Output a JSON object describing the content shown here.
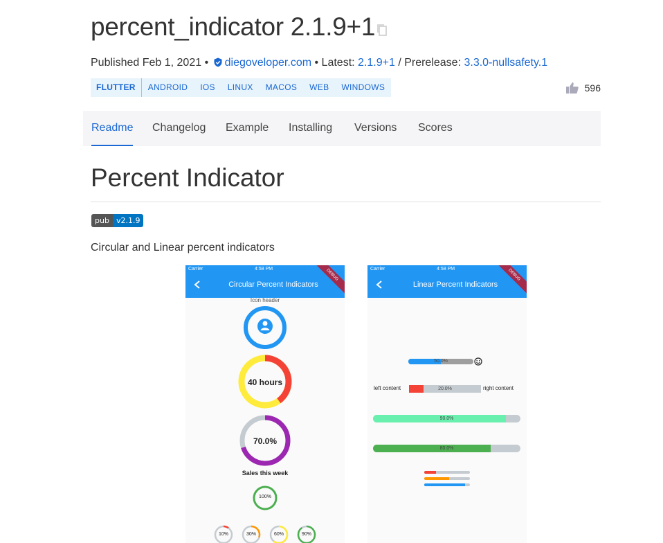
{
  "package": {
    "title": "percent_indicator 2.1.9+1",
    "published_prefix": "Published Feb 1, 2021 •",
    "publisher": "diegoveloper.com",
    "latest_prefix": "• Latest:",
    "latest_version": "2.1.9+1",
    "prerelease_prefix": "/ Prerelease:",
    "prerelease_version": "3.3.0-nullsafety.1",
    "likes": "596"
  },
  "tags": [
    "FLUTTER",
    "ANDROID",
    "IOS",
    "LINUX",
    "MACOS",
    "WEB",
    "WINDOWS"
  ],
  "tabs": [
    {
      "label": "Readme",
      "active": true
    },
    {
      "label": "Changelog"
    },
    {
      "label": "Example"
    },
    {
      "label": "Installing"
    },
    {
      "label": "Versions"
    },
    {
      "label": "Scores"
    }
  ],
  "readme": {
    "title": "Percent Indicator",
    "badge_left": "pub",
    "badge_right": "v2.1.9",
    "description": "Circular and Linear percent indicators"
  },
  "phone_circular": {
    "carrier": "Carrier",
    "time": "4:58 PM",
    "debug": "DEBUG",
    "title": "Circular Percent Indicators",
    "icon_header": "Icon header",
    "hours_label": "40 hours",
    "percent_label": "70.0%",
    "sales_label": "Sales this week",
    "full_label": "100%",
    "small_labels": [
      "10%",
      "30%",
      "60%",
      "90%"
    ],
    "hours_progress": 0.4,
    "percent_progress": 0.7
  },
  "phone_linear": {
    "carrier": "Carrier",
    "time": "4:58 PM",
    "debug": "DEBUG",
    "title": "Linear Percent Indicators",
    "bar1_label": "50.0%",
    "left_content": "left content",
    "bar2_label": "20.0%",
    "right_content": "right content",
    "bar3_label": "90.0%",
    "bar4_label": "80.0%",
    "bar1_progress": 0.5,
    "bar2_progress": 0.2,
    "bar3_progress": 0.9,
    "bar4_progress": 0.8
  },
  "colors": {
    "link": "#1967d2",
    "blue": "#2196f3",
    "yellow": "#ffeb3b",
    "red": "#f44336",
    "purple": "#9c27b0",
    "green": "#4caf50",
    "mint": "#69f0ae",
    "orange": "#ff9800"
  }
}
